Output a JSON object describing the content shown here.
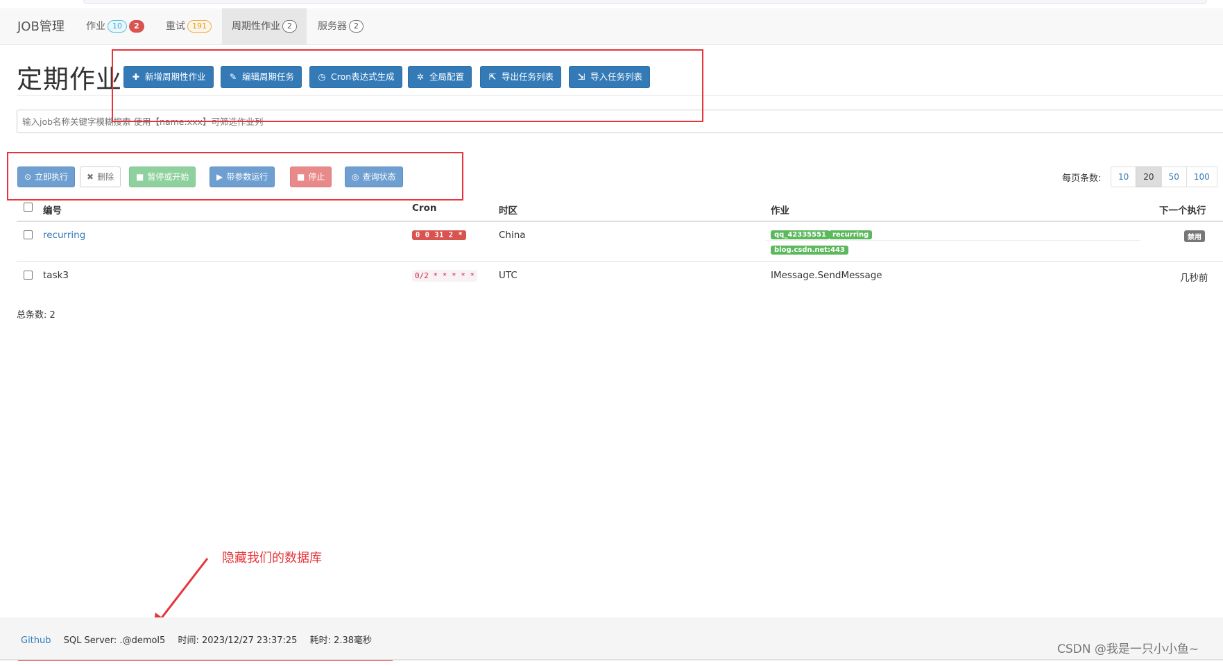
{
  "nav": {
    "brand": "JOB管理",
    "items": [
      {
        "label": "作业",
        "badges": [
          "10",
          "2"
        ]
      },
      {
        "label": "重试",
        "badges": [
          "191"
        ]
      },
      {
        "label": "周期性作业",
        "badges": [
          "2"
        ]
      },
      {
        "label": "服务器",
        "badges": [
          "2"
        ]
      }
    ],
    "active_index": 2
  },
  "header": {
    "title": "定期作业",
    "buttons": [
      {
        "icon": "plus-icon",
        "glyph": "✚",
        "label": "新增周期性作业"
      },
      {
        "icon": "pencil-icon",
        "glyph": "✎",
        "label": "编辑周期任务"
      },
      {
        "icon": "clock-icon",
        "glyph": "◷",
        "label": "Cron表达式生成"
      },
      {
        "icon": "gear-icon",
        "glyph": "✲",
        "label": "全局配置"
      },
      {
        "icon": "export-icon",
        "glyph": "⇱",
        "label": "导出任务列表"
      },
      {
        "icon": "import-icon",
        "glyph": "⇲",
        "label": "导入任务列表"
      }
    ]
  },
  "search": {
    "placeholder": "输入job名称关键字模糊搜索 使用【name:xxx】可筛选作业列"
  },
  "actions": [
    {
      "icon": "play-circle-icon",
      "glyph": "⊙",
      "label": "立即执行",
      "style": "primary"
    },
    {
      "icon": "close-icon",
      "glyph": "✖",
      "label": "删除",
      "style": "default"
    },
    {
      "icon": "pause-icon",
      "glyph": "■",
      "label": "暂停或开始",
      "style": "success"
    },
    {
      "icon": "play-icon",
      "glyph": "▶",
      "label": "带参数运行",
      "style": "info"
    },
    {
      "icon": "stop-icon",
      "glyph": "■",
      "label": "停止",
      "style": "danger"
    },
    {
      "icon": "target-icon",
      "glyph": "◎",
      "label": "查询状态",
      "style": "info"
    }
  ],
  "pager": {
    "label": "每页条数:",
    "options": [
      "10",
      "20",
      "50",
      "100"
    ],
    "selected": "20"
  },
  "table": {
    "columns": [
      "编号",
      "Cron",
      "时区",
      "作业",
      "下一个执行"
    ],
    "rows": [
      {
        "id": "recurring",
        "cron": "0 0 31 2 *",
        "timezone": "China",
        "job_tags": [
          "qq_42335551",
          "recurring",
          "blog.csdn.net:443"
        ],
        "next": "禁用"
      },
      {
        "id": "task3",
        "cron": "0/2 * * * * *",
        "timezone": "UTC",
        "job": "IMessage.SendMessage",
        "next": "几秒前"
      }
    ],
    "total": "总条数: 2"
  },
  "annotation": {
    "text": "隐藏我们的数据库",
    "color": "#e6343a"
  },
  "footer": {
    "github": "Github",
    "server": "SQL Server: .@demol5",
    "time": "时间: 2023/12/27 23:37:25",
    "elapsed": "耗时: 2.38毫秒"
  },
  "watermark": "CSDN @我是一只小小鱼~"
}
